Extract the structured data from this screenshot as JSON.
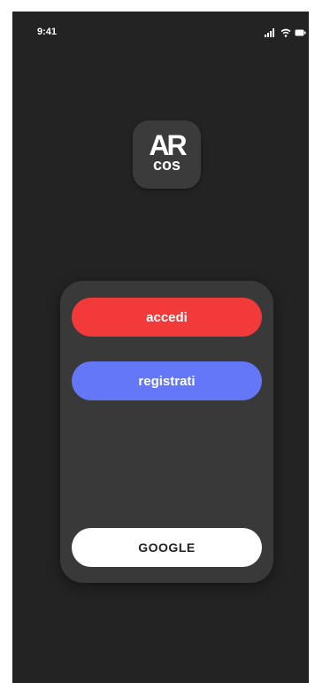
{
  "status_bar": {
    "time": "9:41",
    "icons": [
      "signal-icon",
      "wifi-icon",
      "battery-icon"
    ]
  },
  "logo": {
    "line1": "AR",
    "line2": "cos"
  },
  "auth_card": {
    "login_label": "accedi",
    "register_label": "registrati",
    "google_label": "GOOGLE"
  },
  "colors": {
    "background": "#232323",
    "card": "#393939",
    "login": "#f23a3a",
    "register": "#6377f7",
    "google": "#ffffff"
  }
}
